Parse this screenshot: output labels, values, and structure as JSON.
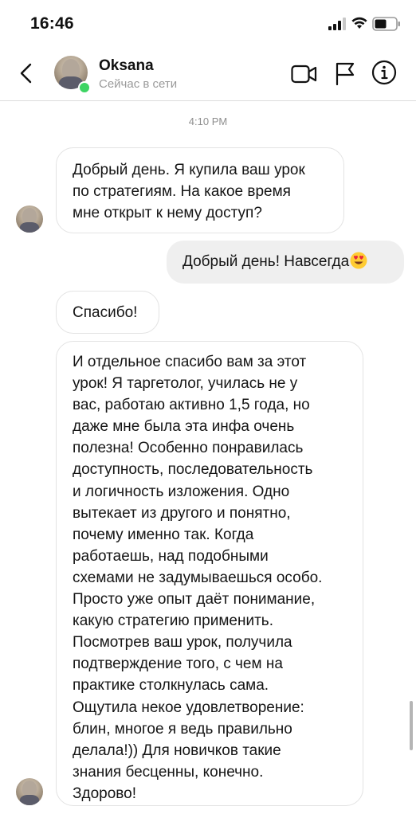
{
  "status_bar": {
    "time": "16:46",
    "icons": [
      "signal-icon",
      "wifi-icon",
      "battery-icon"
    ]
  },
  "header": {
    "contact_name": "Oksana",
    "contact_status": "Сейчас в сети",
    "online_indicator_color": "#3dd463",
    "icons": [
      "back-icon",
      "video-call-icon",
      "flag-icon",
      "info-icon"
    ]
  },
  "chat": {
    "timestamp": "4:10 PM",
    "messages": [
      {
        "direction": "incoming",
        "lines": [
          "Добрый день. Я купила ваш урок",
          "по стратегиям. На какое время",
          "мне открыт к нему доступ?"
        ]
      },
      {
        "direction": "outgoing",
        "text": "Добрый день! Навсегда",
        "emoji": "heart-eyes-emoji-icon"
      },
      {
        "direction": "incoming",
        "text": "Спасибо!"
      },
      {
        "direction": "incoming",
        "lines": [
          "И отдельное спасибо вам за этот",
          "урок! Я таргетолог, училась не у",
          "вас, работаю активно 1,5 года, но",
          "даже мне была эта инфа очень",
          "полезна! Особенно понравилась",
          "доступность, последовательность",
          "и логичность изложения. Одно",
          "вытекает из другого и понятно,",
          "почему именно так. Когда",
          "работаешь, над подобными",
          "схемами не задумываешься особо.",
          "Просто уже опыт даёт понимание,",
          "какую стратегию применить.",
          "Посмотрев ваш урок, получила",
          "подтверждение того, с чем на",
          "практике столкнулась сама.",
          "Ощутила некое удовлетворение:",
          "блин, многое я ведь правильно",
          "делала!)) Для новичков такие",
          "знания бесценны, конечно.",
          "Здорово!"
        ]
      }
    ]
  },
  "colors": {
    "outgoing_bubble": "#efefef",
    "incoming_border": "#e3e3e3",
    "secondary_text": "#9a9a9a"
  }
}
